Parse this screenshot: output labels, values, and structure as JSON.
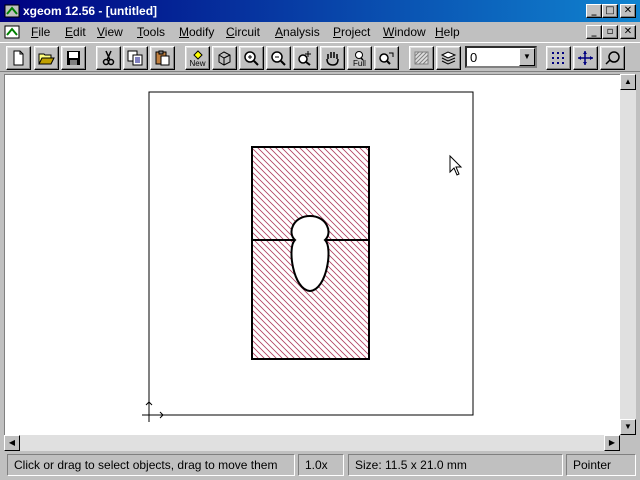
{
  "window": {
    "title": "xgeom 12.56 - [untitled]"
  },
  "menu": [
    {
      "key": "F",
      "rest": "ile"
    },
    {
      "key": "E",
      "rest": "dit"
    },
    {
      "key": "V",
      "rest": "iew"
    },
    {
      "key": "T",
      "rest": "ools"
    },
    {
      "key": "M",
      "rest": "odify"
    },
    {
      "key": "C",
      "rest": "ircuit"
    },
    {
      "key": "A",
      "rest": "nalysis"
    },
    {
      "key": "P",
      "rest": "roject"
    },
    {
      "key": "W",
      "rest": "indow"
    },
    {
      "key": "H",
      "rest": "elp"
    }
  ],
  "toolbar": {
    "new_label": "New",
    "full_label": "Full",
    "layer_value": "0"
  },
  "icons": {
    "new": "new-file-icon",
    "open": "open-folder-icon",
    "save": "save-disk-icon",
    "cut": "scissors-icon",
    "copy": "copy-icon",
    "paste": "paste-icon",
    "new_geom": "new-geometry-icon",
    "layers3d": "3d-box-icon",
    "zoom_in": "zoom-in-icon",
    "zoom_out": "zoom-out-icon",
    "zoom_region": "zoom-region-icon",
    "pan": "hand-pan-icon",
    "zoom_full": "zoom-full-icon",
    "refresh": "regenerate-icon",
    "hatch": "hatch-icon",
    "layer_stack": "layer-stack-icon",
    "grid": "grid-icon",
    "move": "move-arrows-icon",
    "snap": "snap-icon"
  },
  "status": {
    "hint": "Click or drag to select objects, drag to move them",
    "zoom": "1.0x",
    "size": "Size: 11.5 x 21.0 mm",
    "mode": "Pointer"
  },
  "colors": {
    "titlebar": "#000080",
    "hatch": "#b04060"
  }
}
